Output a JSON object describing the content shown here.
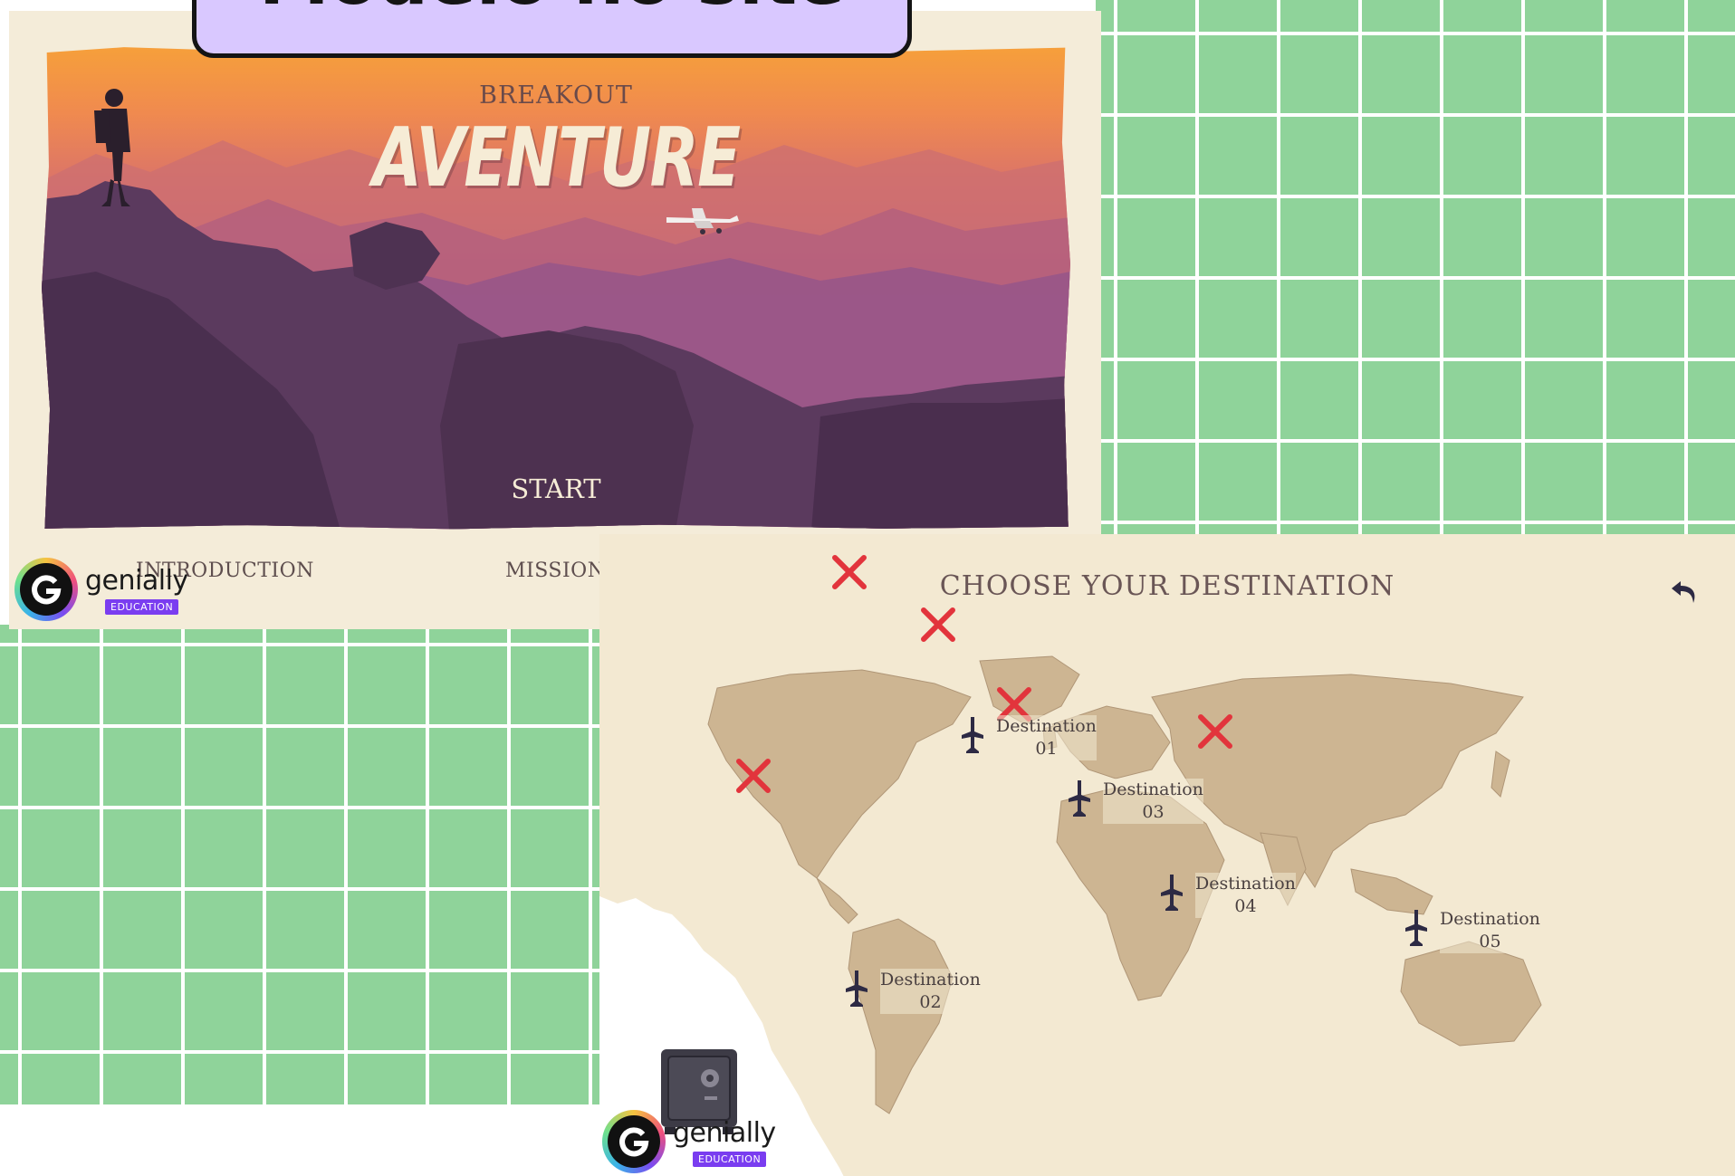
{
  "top_tab": {
    "text": "Modelo no site"
  },
  "cover": {
    "subtitle": "BREAKOUT",
    "title": "AVENTURE",
    "start_label": "START",
    "nav": {
      "introduction": "INTRODUCTION",
      "mission": "MISSION"
    }
  },
  "logo": {
    "word": "genially",
    "badge": "EDUCATION"
  },
  "map": {
    "title": "CHOOSE YOUR DESTINATION",
    "destinations": [
      {
        "label": "Destination",
        "number": "01"
      },
      {
        "label": "Destination",
        "number": "02"
      },
      {
        "label": "Destination",
        "number": "03"
      },
      {
        "label": "Destination",
        "number": "04"
      },
      {
        "label": "Destination",
        "number": "05"
      }
    ]
  },
  "colors": {
    "background_green": "#8fd39a",
    "tab_purple": "#d9c8ff",
    "paper": "#f3e9d2",
    "marker_red": "#e2343c",
    "plane_dark": "#2d2a44"
  },
  "icons": [
    "back-arrow-icon",
    "airplane-icon",
    "x-marker-icon",
    "safe-icon",
    "genially-logo"
  ]
}
